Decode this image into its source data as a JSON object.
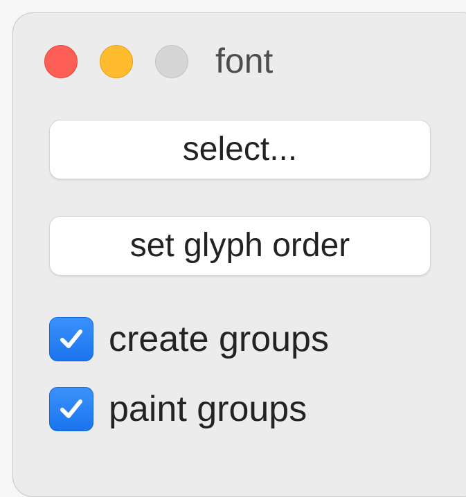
{
  "window": {
    "title": "font",
    "controls": [
      {
        "name": "close",
        "color": "#fd5f57"
      },
      {
        "name": "minimize",
        "color": "#febc2e"
      },
      {
        "name": "zoom",
        "color": "#d5d5d5"
      }
    ]
  },
  "buttons": {
    "select_label": "select...",
    "glyph_order_label": "set glyph order"
  },
  "checkboxes": [
    {
      "label": "create groups",
      "checked": true
    },
    {
      "label": "paint groups",
      "checked": true
    }
  ],
  "colors": {
    "accent": "#1f7cf5",
    "window_bg": "#ececec"
  }
}
